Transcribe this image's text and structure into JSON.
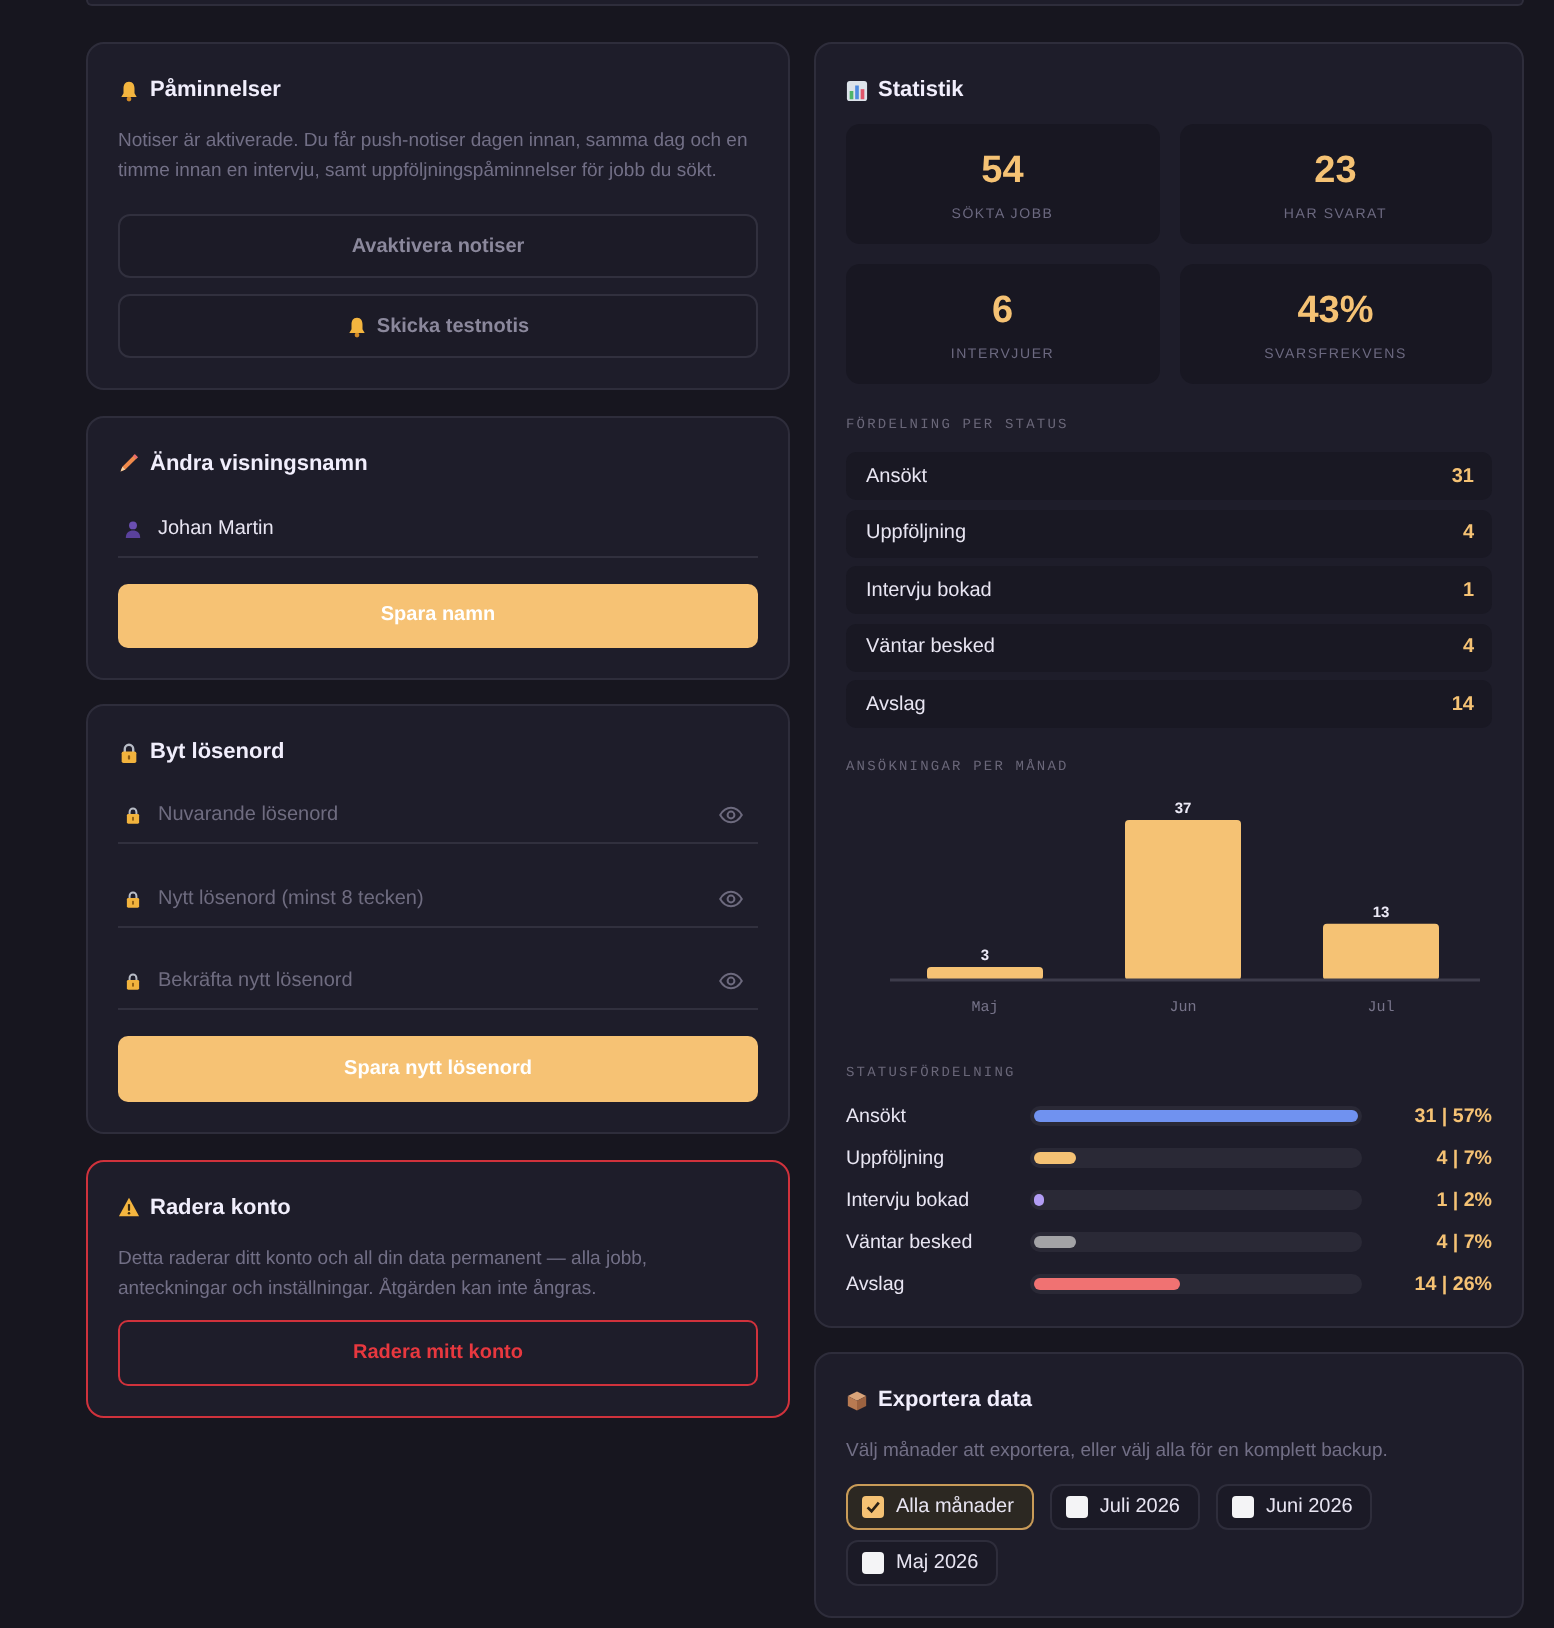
{
  "reminders": {
    "title": "Påminnelser",
    "description": "Notiser är aktiverade. Du får push-notiser dagen innan, samma dag och en timme innan en intervju, samt uppföljningspåminnelser för jobb du sökt.",
    "deactivate_button": "Avaktivera notiser",
    "test_button": "Skicka testnotis"
  },
  "display_name": {
    "title": "Ändra visningsnamn",
    "value": "Johan Martin",
    "save_button": "Spara namn"
  },
  "password": {
    "title": "Byt lösenord",
    "fields": [
      {
        "placeholder": "Nuvarande lösenord"
      },
      {
        "placeholder": "Nytt lösenord (minst 8 tecken)"
      },
      {
        "placeholder": "Bekräfta nytt lösenord"
      }
    ],
    "save_button": "Spara nytt lösenord"
  },
  "delete_account": {
    "title": "Radera konto",
    "description": "Detta raderar ditt konto och all din data permanent — alla jobb, anteckningar och inställningar. Åtgärden kan inte ångras.",
    "button": "Radera mitt konto"
  },
  "statistics": {
    "title": "Statistik",
    "tiles": [
      {
        "value": "54",
        "label": "SÖKTA JOBB"
      },
      {
        "value": "23",
        "label": "HAR SVARAT"
      },
      {
        "value": "6",
        "label": "INTERVJUER"
      },
      {
        "value": "43%",
        "label": "SVARSFREKVENS"
      }
    ],
    "status_heading": "FÖRDELNING PER STATUS",
    "status_rows": [
      {
        "label": "Ansökt",
        "count": "31"
      },
      {
        "label": "Uppföljning",
        "count": "4"
      },
      {
        "label": "Intervju bokad",
        "count": "1"
      },
      {
        "label": "Väntar besked",
        "count": "4"
      },
      {
        "label": "Avslag",
        "count": "14"
      }
    ],
    "monthly": {
      "chart_data": {
        "type": "bar",
        "title": "ANSÖKNINGAR PER MÅNAD",
        "categories": [
          "Maj",
          "Jun",
          "Jul"
        ],
        "values": [
          3,
          37,
          13
        ],
        "data_labels": true
      }
    },
    "distribution_heading": "STATUSFÖRDELNING",
    "distribution": [
      {
        "label": "Ansökt",
        "color": "#7092f0",
        "level": 1,
        "reading": "31 | 57%"
      },
      {
        "label": "Uppföljning",
        "color": "#f5c274",
        "level": 0.129,
        "reading": "4 | 7%"
      },
      {
        "label": "Intervju bokad",
        "color": "#b29cf4",
        "level": 0.032,
        "reading": "1 | 2%"
      },
      {
        "label": "Väntar besked",
        "color": "#a3a3a6",
        "level": 0.129,
        "reading": "4 | 7%"
      },
      {
        "label": "Avslag",
        "color": "#f07272",
        "level": 0.452,
        "reading": "14 | 26%"
      }
    ]
  },
  "export": {
    "title": "Exportera data",
    "description": "Välj månader att exportera, eller välj alla för en komplett backup.",
    "options": [
      {
        "label": "Alla månader",
        "checked": true
      },
      {
        "label": "Juli 2026",
        "checked": false
      },
      {
        "label": "Juni 2026",
        "checked": false
      },
      {
        "label": "Maj 2026",
        "checked": false
      }
    ]
  }
}
